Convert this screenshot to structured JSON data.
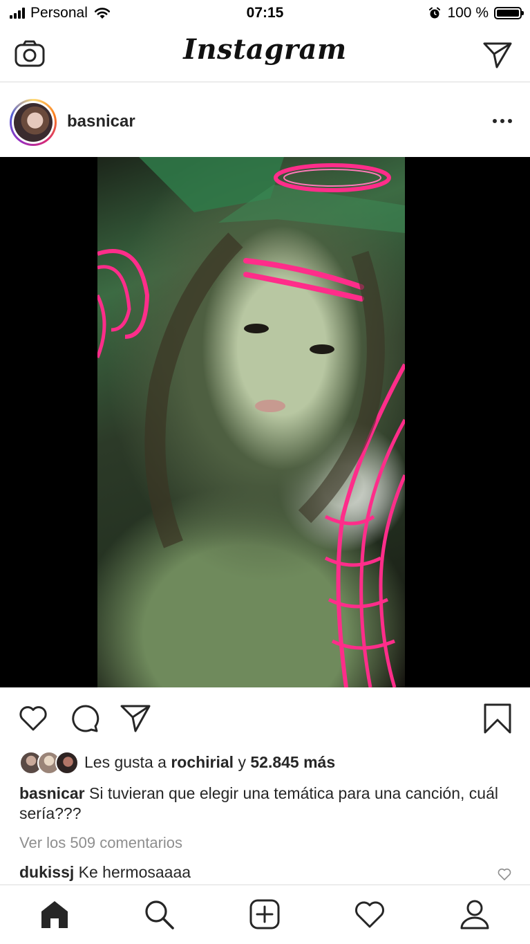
{
  "status_bar": {
    "carrier": "Personal",
    "time": "07:15",
    "battery_percent": "100 %",
    "battery_level": 1.0,
    "icons": [
      "signal-icon",
      "wifi-icon",
      "alarm-icon",
      "battery-icon"
    ]
  },
  "header": {
    "logo_text": "Instagram",
    "icons": [
      "camera-icon",
      "direct-message-icon"
    ]
  },
  "post": {
    "username": "basnicar",
    "media": "selfie with neon halo and wing lights",
    "actions": [
      "heart-icon",
      "comment-icon",
      "share-icon",
      "bookmark-icon"
    ],
    "likes": {
      "prefix": "Les gusta a",
      "user": "rochirial",
      "connector": "y",
      "count_text": "52.845 más"
    },
    "caption": {
      "user": "basnicar",
      "text": "Si tuvieran que elegir una temática para una canción, cuál sería???"
    },
    "view_comments": "Ver los 509 comentarios",
    "comment": {
      "user": "dukissj",
      "text": "Ke hermosaaaa"
    }
  },
  "tab_bar": {
    "items": [
      "home-icon",
      "search-icon",
      "new-post-icon",
      "activity-icon",
      "profile-icon"
    ]
  },
  "colors": {
    "text": "#262626",
    "muted": "#8e8e8e",
    "divider": "#dbdbdb",
    "neon_pink": "#ff2d8a"
  }
}
